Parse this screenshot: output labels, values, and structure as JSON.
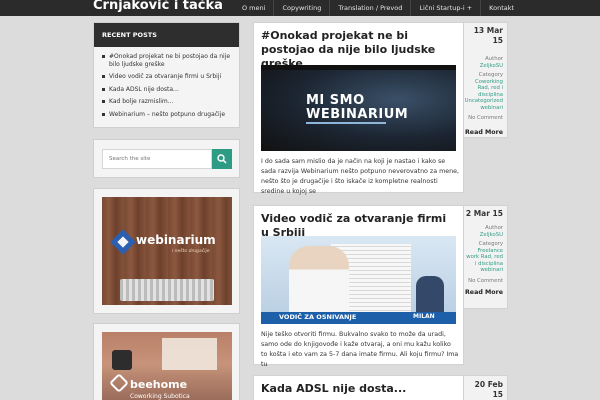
{
  "site_title": "Crnjaković i tačka",
  "nav": [
    "O meni",
    "Copywriting",
    "Translation / Prevod",
    "Lični Startup-i +",
    "Kontakt"
  ],
  "sidebar": {
    "recent_heading": "RECENT POSTS",
    "recent_posts": [
      "#Onokad projekat ne bi postojao da nije bilo ljudske greške",
      "Video vodič za otvaranje firmi u Srbiji",
      "Kada ADSL nije dosta...",
      "Kad bolje razmislim...",
      "Webinarium – nešto potpuno drugačije"
    ],
    "search_placeholder": "Search the site",
    "banner1": {
      "logo": "webinarium",
      "tagline": "i nešto drugačije"
    },
    "banner2": {
      "logo": "beehome",
      "sub": "Coworking Subotica"
    }
  },
  "posts": [
    {
      "title": "#Onokad projekat ne bi postojao da nije bilo ljudske greške",
      "image_text": [
        "MI SMO",
        "WEBINARIUM"
      ],
      "excerpt": "I do sada sam mislio da je način na koji je nastao i kako se sada razvija Webinarium nešto potpuno neverovatno za mene, nešto što je drugačije i što iskače iz kompletne realnosti sredine u kojoj se",
      "date": "13 Mar 15",
      "author_label": "Author",
      "author": "ZeljkoSU",
      "category_label": "Category",
      "categories": "Coworking Rad, red i disciplina Uncategorized webinari",
      "comments": "No Comment",
      "read_more": "Read More"
    },
    {
      "title": "Video vodič za otvaranje firmi u Srbiji",
      "image_caption": "VODIČ ZA OSNIVANJE",
      "image_name": "MILAN",
      "excerpt": "Nije teško otvoriti firmu. Bukvalno svako to može da uradi, samo ode do knjigovođe i kaže otvaraj, a oni mu kažu koliko to košta i eto vam za 5-7 dana imate firmu. Ali koju firmu? Ima tu",
      "date": "2 Mar 15",
      "author_label": "Author",
      "author": "ZeljkoSU",
      "category_label": "Category",
      "categories": "Freelance work Rad, red i disciplina webinari",
      "comments": "No Comment",
      "read_more": "Read More"
    },
    {
      "title": "Kada ADSL nije dosta...",
      "date": "20 Feb 15"
    }
  ],
  "colors": {
    "accent": "#2e9c84",
    "topbar": "#2b2b2b",
    "background": "#dcdcdc"
  }
}
